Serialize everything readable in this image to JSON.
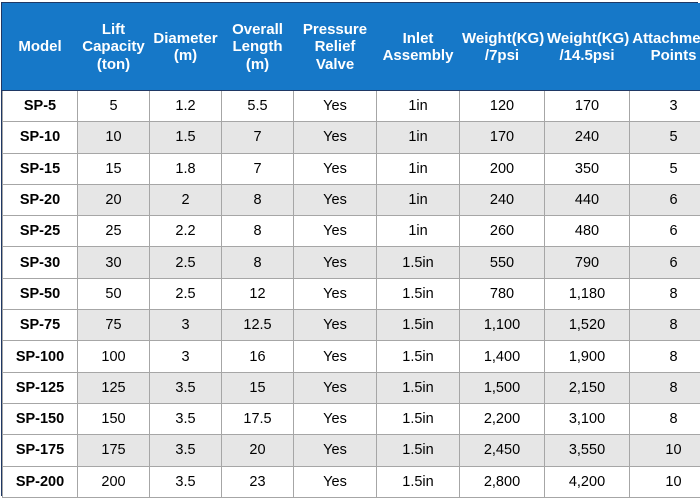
{
  "table": {
    "headers": [
      "Model",
      "Lift Capacity (ton)",
      "Diameter (m)",
      "Overall Length (m)",
      "Pressure Relief Valve",
      "Inlet Assembly",
      "Weight(KG) /7psi",
      "Weight(KG) /14.5psi",
      "Attachment Points"
    ],
    "header_lines": [
      [
        "Model"
      ],
      [
        "Lift",
        "Capacity",
        "(ton)"
      ],
      [
        "Diameter",
        "(m)"
      ],
      [
        "Overall",
        "Length",
        "(m)"
      ],
      [
        "Pressure",
        "Relief",
        "Valve"
      ],
      [
        "Inlet",
        "Assembly"
      ],
      [
        "Weight(KG)",
        "/7psi"
      ],
      [
        "Weight(KG)",
        "/14.5psi"
      ],
      [
        "Attachment",
        "Points"
      ]
    ],
    "rows": [
      [
        "SP-5",
        "5",
        "1.2",
        "5.5",
        "Yes",
        "1in",
        "120",
        "170",
        "3"
      ],
      [
        "SP-10",
        "10",
        "1.5",
        "7",
        "Yes",
        "1in",
        "170",
        "240",
        "5"
      ],
      [
        "SP-15",
        "15",
        "1.8",
        "7",
        "Yes",
        "1in",
        "200",
        "350",
        "5"
      ],
      [
        "SP-20",
        "20",
        "2",
        "8",
        "Yes",
        "1in",
        "240",
        "440",
        "6"
      ],
      [
        "SP-25",
        "25",
        "2.2",
        "8",
        "Yes",
        "1in",
        "260",
        "480",
        "6"
      ],
      [
        "SP-30",
        "30",
        "2.5",
        "8",
        "Yes",
        "1.5in",
        "550",
        "790",
        "6"
      ],
      [
        "SP-50",
        "50",
        "2.5",
        "12",
        "Yes",
        "1.5in",
        "780",
        "1,180",
        "8"
      ],
      [
        "SP-75",
        "75",
        "3",
        "12.5",
        "Yes",
        "1.5in",
        "1,100",
        "1,520",
        "8"
      ],
      [
        "SP-100",
        "100",
        "3",
        "16",
        "Yes",
        "1.5in",
        "1,400",
        "1,900",
        "8"
      ],
      [
        "SP-125",
        "125",
        "3.5",
        "15",
        "Yes",
        "1.5in",
        "1,500",
        "2,150",
        "8"
      ],
      [
        "SP-150",
        "150",
        "3.5",
        "17.5",
        "Yes",
        "1.5in",
        "2,200",
        "3,100",
        "8"
      ],
      [
        "SP-175",
        "175",
        "3.5",
        "20",
        "Yes",
        "1.5in",
        "2,450",
        "3,550",
        "10"
      ],
      [
        "SP-200",
        "200",
        "3.5",
        "23",
        "Yes",
        "1.5in",
        "2,800",
        "4,200",
        "10"
      ]
    ]
  },
  "colors": {
    "header_background": "#1678c8",
    "header_text": "#ffffff",
    "row_alt_background": "#e6e6e6",
    "row_background": "#ffffff",
    "cell_border": "#a6a6a6",
    "outer_border": "#1f3864",
    "body_text": "#000000"
  }
}
